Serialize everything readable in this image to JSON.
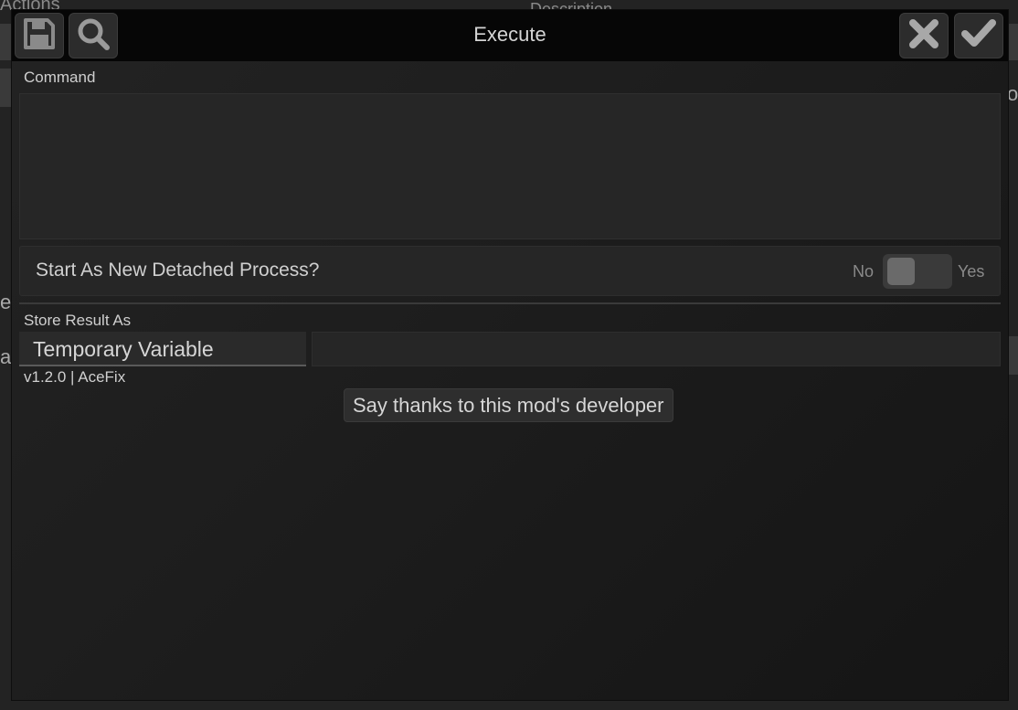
{
  "background": {
    "actions_label": "Actions",
    "description_label": "Description",
    "frag_left_1": "er",
    "frag_left_2": "a",
    "frag_right": "o"
  },
  "dialog": {
    "title": "Execute",
    "icons": {
      "save": "save-icon",
      "search": "search-icon",
      "cancel": "close-icon",
      "confirm": "check-icon"
    },
    "command_label": "Command",
    "command_value": "",
    "detached": {
      "label": "Start As New Detached Process?",
      "no_label": "No",
      "yes_label": "Yes",
      "value": false
    },
    "store_result_label": "Store Result As",
    "store_result_type": "Temporary Variable",
    "store_result_name": "",
    "version_text": "v1.2.0 | AceFix",
    "thanks_button": "Say thanks to this mod's developer"
  },
  "colors": {
    "dialog_bg": "#1d1d1d",
    "titlebar_bg": "#060606",
    "field_bg": "#262626",
    "text": "#c8c8c8"
  }
}
